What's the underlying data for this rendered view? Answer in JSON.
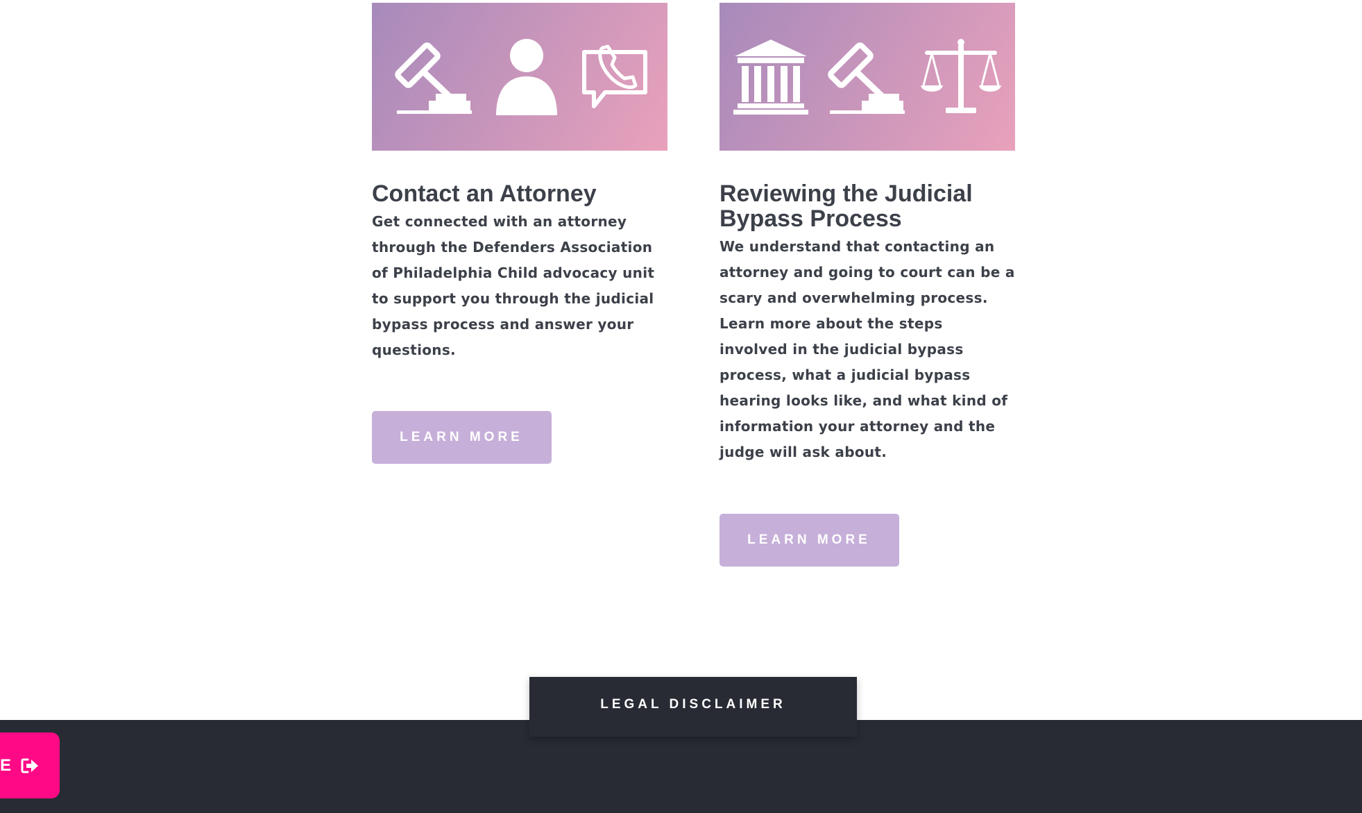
{
  "colors": {
    "heading_text": "#3c4049",
    "body_text": "#3c4049",
    "banner_gradient_start": "#a78abb",
    "banner_gradient_end": "#e9a1bb",
    "button_bg": "#c6afd9",
    "footer_bg": "#282b34",
    "disclaimer_tab_bg": "#282b34",
    "exit_button_bg": "#ff0a86",
    "icon_fill": "#ffffff"
  },
  "cards": [
    {
      "icons": [
        "gavel-icon",
        "person-icon",
        "phone-chat-icon"
      ],
      "title": "Contact an Attorney",
      "body": "Get connected with an attorney through the Defenders Association of Philadelphia Child advocacy unit to support you through the judicial bypass process and answer your questions.",
      "button_label": "LEARN MORE"
    },
    {
      "icons": [
        "courthouse-icon",
        "gavel-icon",
        "scales-of-justice-icon"
      ],
      "title": "Reviewing the Judicial Bypass Process",
      "body": "We understand that contacting an attorney and going to court can be a scary and overwhelming process. Learn more about the steps involved in the judicial bypass process, what a judicial bypass hearing looks like, and what kind of information your attorney and the judge will ask about.",
      "button_label": "LEARN MORE"
    }
  ],
  "footer": {
    "disclaimer_label": "LEGAL DISCLAIMER"
  },
  "exit_button": {
    "partial_text": "E",
    "icon": "exit-door-arrow-icon"
  }
}
